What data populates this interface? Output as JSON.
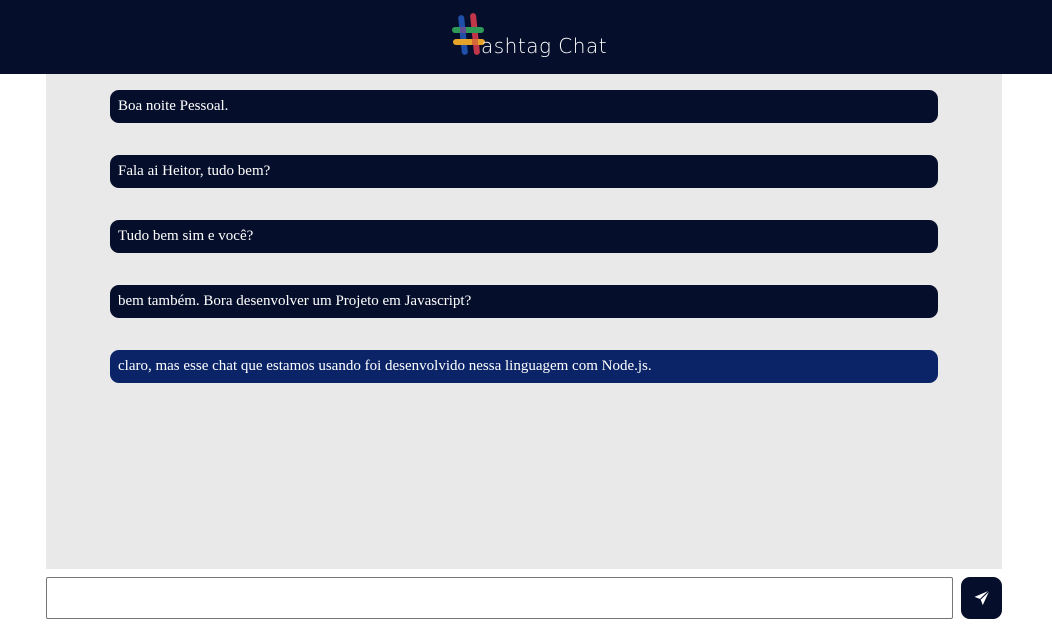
{
  "header": {
    "logo_text": "ashtag Chat",
    "logo_icon": "hashtag-logo-icon"
  },
  "chat": {
    "messages": [
      {
        "text": "Boa noite Pessoal.",
        "own": false
      },
      {
        "text": "Fala ai Heitor, tudo bem?",
        "own": false
      },
      {
        "text": "Tudo bem sim e você?",
        "own": false
      },
      {
        "text": "bem também. Bora desenvolver um Projeto em Javascript?",
        "own": false
      },
      {
        "text": "claro, mas esse chat que estamos usando foi desenvolvido nessa linguagem com Node.js.",
        "own": true
      }
    ]
  },
  "composer": {
    "input_value": "",
    "input_placeholder": "",
    "send_icon": "paper-plane-icon"
  },
  "colors": {
    "header_bg": "#050e2a",
    "message_bg": "#050e2a",
    "own_message_bg": "#0b2468",
    "chat_bg": "#e9e9e9"
  }
}
